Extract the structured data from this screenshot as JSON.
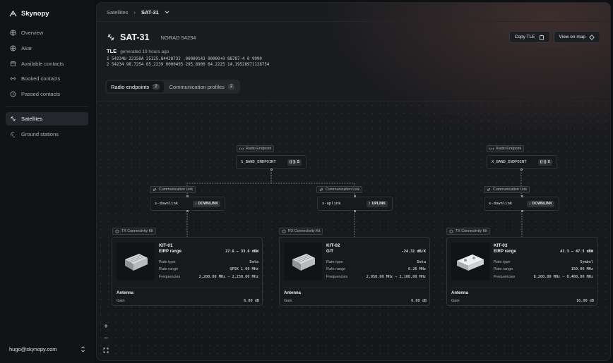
{
  "app": {
    "name": "Skynopy"
  },
  "sidebar": {
    "items": [
      {
        "label": "Overview",
        "icon": "globe-icon"
      },
      {
        "label": "Akar",
        "icon": "globe-icon"
      },
      {
        "label": "Available contacts",
        "icon": "calendar-icon"
      },
      {
        "label": "Booked contacts",
        "icon": "contacts-icon"
      },
      {
        "label": "Passed contacts",
        "icon": "history-icon"
      }
    ],
    "items2": [
      {
        "label": "Satellites",
        "icon": "satellite-icon",
        "active": true
      },
      {
        "label": "Ground stations",
        "icon": "ground-station-icon"
      }
    ],
    "user": "hugo@skynopy.com"
  },
  "breadcrumb": {
    "parent": "Satellites",
    "current": "SAT-31"
  },
  "satellite": {
    "name": "SAT-31",
    "norad": "NORAD 54234"
  },
  "header_buttons": {
    "copy_tle": "Copy TLE",
    "view_on_map": "View on map"
  },
  "tle": {
    "label": "TLE",
    "generated": "generated 19 hours ago",
    "line1": "1 54234U 22150A 25125.84428732 .00000143 00000+0 88787-4 0 9990",
    "line2": "2 54234 98.7254 65.2239 0000495 295.8900 64.2225 14.19528971128754"
  },
  "tabs": [
    {
      "label": "Radio endpoints",
      "count": "2",
      "active": true
    },
    {
      "label": "Communication profiles",
      "count": "2",
      "active": false
    }
  ],
  "graph": {
    "tags": {
      "radio_endpoint": "Radio Endpoint",
      "comm_link": "Communication Link",
      "tx_kit": "TX Connectivity Kit",
      "rx_kit": "RX Connectivity Kit"
    },
    "endpoints": [
      {
        "name": "S_BAND_ENDPOINT",
        "band": "S"
      },
      {
        "name": "X_BAND_ENDPOINT",
        "band": "X"
      }
    ],
    "links": [
      {
        "name": "s-downlink",
        "direction": "DOWNLINK"
      },
      {
        "name": "s-uplink",
        "direction": "UPLINK"
      },
      {
        "name": "x-downlink",
        "direction": "DOWNLINK"
      }
    ],
    "kits": [
      {
        "name": "KIT-01",
        "metric_label": "EIRP range",
        "metric_value": "27.6 – 33.6 dBW",
        "rate_type": "Data",
        "rate_range": "QPSK 1.00 MHz",
        "frequencies": "2,200.00 MHz – 2,250.00 MHz",
        "gain": "6.00 dB"
      },
      {
        "name": "KIT-02",
        "metric_label": "G/T",
        "metric_value": "-24.31 dB/K",
        "rate_type": "Data",
        "rate_range": "0.26 MHz",
        "frequencies": "2,050.00 MHz – 2,100.00 MHz",
        "gain": "6.00 dB"
      },
      {
        "name": "KIT-03",
        "metric_label": "EIRP range",
        "metric_value": "41.3 – 47.3 dBW",
        "rate_type": "Symbol",
        "rate_range": "150.00 MHz",
        "frequencies": "8,200.00 MHz – 8,400.00 MHz",
        "gain": "16.00 dB"
      }
    ],
    "labels": {
      "rate_type": "Rate type",
      "rate_range": "Rate range",
      "frequencies": "Frequencies",
      "antenna": "Antenna",
      "gain": "Gain"
    }
  },
  "zoom": {
    "in": "+",
    "out": "−"
  }
}
